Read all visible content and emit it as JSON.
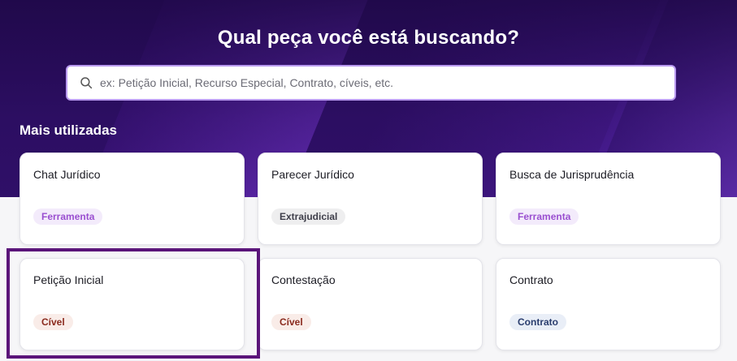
{
  "header": {
    "title": "Qual peça você está buscando?"
  },
  "search": {
    "placeholder": "ex: Petição Inicial, Recurso Especial, Contrato, cíveis, etc.",
    "value": ""
  },
  "section": {
    "title": "Mais utilizadas"
  },
  "cards": [
    {
      "name": "Chat Jurídico",
      "tag": "Ferramenta"
    },
    {
      "name": "Parecer Jurídico",
      "tag": "Extrajudicial"
    },
    {
      "name": "Busca de Jurisprudência",
      "tag": "Ferramenta"
    },
    {
      "name": "Petição Inicial",
      "tag": "Cível"
    },
    {
      "name": "Contestação",
      "tag": "Cível"
    },
    {
      "name": "Contrato",
      "tag": "Contrato"
    }
  ],
  "colors": {
    "hero_bg": "#2e0f66",
    "search_border": "#b99af0",
    "highlight_border": "#5b157a"
  }
}
